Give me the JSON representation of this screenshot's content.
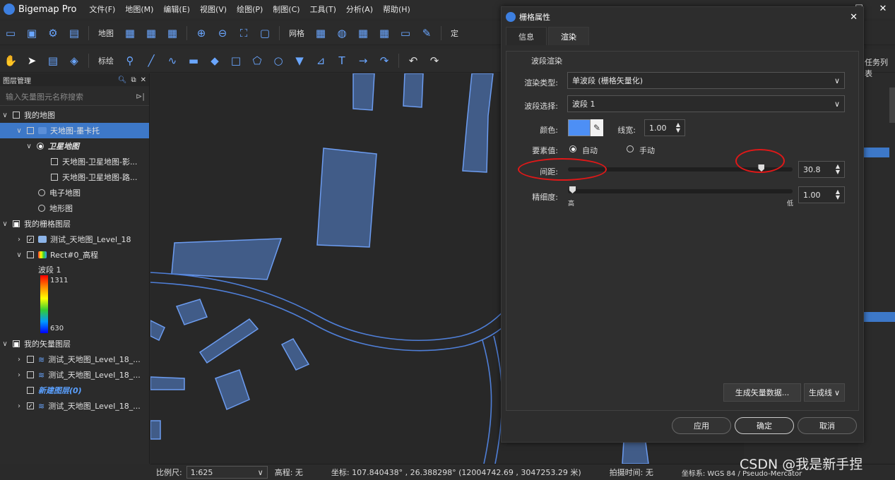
{
  "app": {
    "title": "Bigemap Pro",
    "menu": [
      "文件(F)",
      "地图(M)",
      "编辑(E)",
      "视图(V)",
      "绘图(P)",
      "制图(C)",
      "工具(T)",
      "分析(A)",
      "帮助(H)"
    ]
  },
  "toolbar1": {
    "map_label": "地图",
    "grid_label": "网格",
    "partial_label": "定"
  },
  "toolbar2": {
    "draw_label": "标绘"
  },
  "layers_panel": {
    "title": "图层管理",
    "search_placeholder": "输入矢量图元名称搜索",
    "rows": [
      {
        "label": "我的地图"
      },
      {
        "label": "天地图-墨卡托"
      },
      {
        "label": "卫星地图"
      },
      {
        "label": "天地图-卫星地图-影..."
      },
      {
        "label": "天地图-卫星地图-路..."
      },
      {
        "label": "电子地图"
      },
      {
        "label": "地形图"
      },
      {
        "label": "我的栅格图层"
      },
      {
        "label": "测试_天地图_Level_18"
      },
      {
        "label": "Rect#0_高程"
      },
      {
        "label": "我的矢量图层"
      },
      {
        "label": "测试_天地图_Level_18_..."
      },
      {
        "label": "测试_天地图_Level_18_..."
      },
      {
        "label": "新建图层(0)"
      },
      {
        "label": "测试_天地图_Level_18_..."
      }
    ],
    "legend": {
      "band": "波段 1",
      "max": "1311",
      "min": "630"
    }
  },
  "status": {
    "scale_label": "比例尺:",
    "scale_value": "1:625",
    "elevation": "高程: 无",
    "coords": "坐标: 107.840438° , 26.388298°  (12004742.69 , 3047253.29 米)",
    "capture_time": "拍摄时间: 无",
    "crs": "坐标系: WGS 84 / Pseudo-Mercator"
  },
  "right_panel": {
    "task_list": "任务列表"
  },
  "watermark": "CSDN @我是新手捏",
  "dialog": {
    "title": "栅格属性",
    "tabs": [
      "信息",
      "渲染"
    ],
    "group": "波段渲染",
    "render_type_label": "渲染类型:",
    "render_type_value": "单波段 (栅格矢量化)",
    "band_label": "波段选择:",
    "band_value": "波段 1",
    "color_label": "颜色:",
    "line_width_label": "线宽:",
    "line_width_value": "1.00",
    "element_value_label": "要素值:",
    "auto_label": "自动",
    "manual_label": "手动",
    "interval_label": "间距:",
    "interval_value": "30.8",
    "interval_fraction": 0.86,
    "precision_label": "精细度:",
    "precision_value": "1.00",
    "precision_fraction": 0.0,
    "precision_high": "高",
    "precision_low": "低",
    "gen_vector_btn": "生成矢量数据...",
    "gen_line_btn": "生成线",
    "apply_btn": "应用",
    "ok_btn": "确定",
    "cancel_btn": "取消",
    "color_hex": "#4d8ff5"
  }
}
